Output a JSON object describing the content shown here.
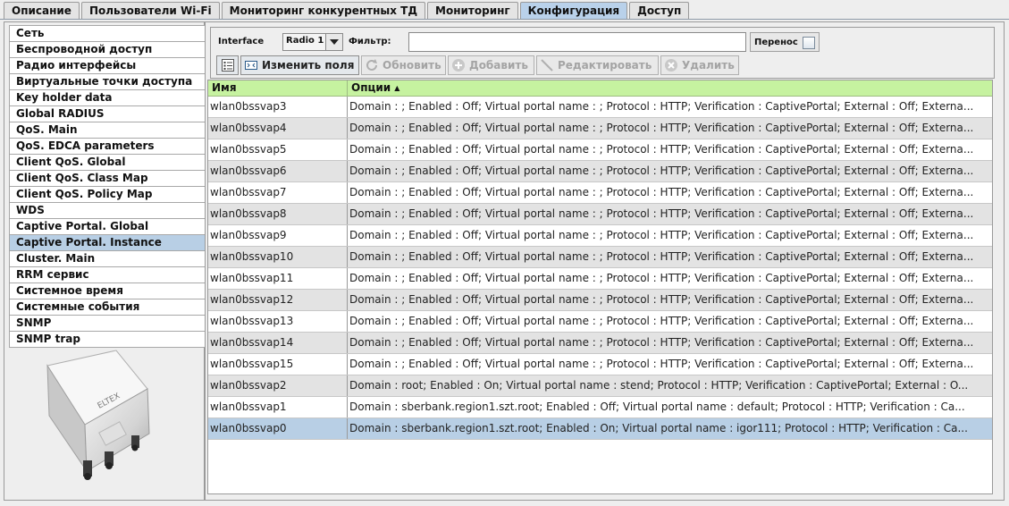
{
  "tabs": [
    {
      "label": "Описание",
      "active": false
    },
    {
      "label": "Пользователи Wi-Fi",
      "active": false
    },
    {
      "label": "Мониторинг конкурентных ТД",
      "active": false
    },
    {
      "label": "Мониторинг",
      "active": false
    },
    {
      "label": "Конфигурация",
      "active": true
    },
    {
      "label": "Доступ",
      "active": false
    }
  ],
  "menu": {
    "items": [
      "Сеть",
      "Беспроводной доступ",
      "Радио интерфейсы",
      "Виртуальные точки доступа",
      "Key holder data",
      "Global RADIUS",
      "QoS. Main",
      "QoS. EDCA parameters",
      "Client QoS. Global",
      "Client QoS. Class Map",
      "Client QoS. Policy Map",
      "WDS",
      "Captive Portal. Global",
      "Captive Portal. Instance",
      "Cluster. Main",
      "RRM сервис",
      "Системное время",
      "Системные события",
      "SNMP",
      "SNMP trap"
    ],
    "selected": "Captive Portal. Instance"
  },
  "device": {
    "brand_label": "ELTEX"
  },
  "filters": {
    "interface_label": "Interface",
    "interface_value": "Radio 1",
    "filter_label": "Фильтр:",
    "filter_value": "",
    "wrap_label": "Перенос",
    "wrap_checked": false
  },
  "toolbar": {
    "change_fields": "Изменить поля",
    "refresh": "Обновить",
    "add": "Добавить",
    "edit": "Редактировать",
    "delete": "Удалить"
  },
  "table": {
    "columns": [
      "Имя",
      "Опции"
    ],
    "sorted_column": "Опции",
    "sort_direction": "ascending",
    "header_color": "#c6f2a0",
    "selected_row": "wlan0bssvap0",
    "rows": [
      {
        "name": "wlan0bssvap3",
        "options": "Domain : ; Enabled : Off; Virtual portal name : ; Protocol : HTTP; Verification : CaptivePortal; External : Off; Externa..."
      },
      {
        "name": "wlan0bssvap4",
        "options": "Domain : ; Enabled : Off; Virtual portal name : ; Protocol : HTTP; Verification : CaptivePortal; External : Off; Externa..."
      },
      {
        "name": "wlan0bssvap5",
        "options": "Domain : ; Enabled : Off; Virtual portal name : ; Protocol : HTTP; Verification : CaptivePortal; External : Off; Externa..."
      },
      {
        "name": "wlan0bssvap6",
        "options": "Domain : ; Enabled : Off; Virtual portal name : ; Protocol : HTTP; Verification : CaptivePortal; External : Off; Externa..."
      },
      {
        "name": "wlan0bssvap7",
        "options": "Domain : ; Enabled : Off; Virtual portal name : ; Protocol : HTTP; Verification : CaptivePortal; External : Off; Externa..."
      },
      {
        "name": "wlan0bssvap8",
        "options": "Domain : ; Enabled : Off; Virtual portal name : ; Protocol : HTTP; Verification : CaptivePortal; External : Off; Externa..."
      },
      {
        "name": "wlan0bssvap9",
        "options": "Domain : ; Enabled : Off; Virtual portal name : ; Protocol : HTTP; Verification : CaptivePortal; External : Off; Externa..."
      },
      {
        "name": "wlan0bssvap10",
        "options": "Domain : ; Enabled : Off; Virtual portal name : ; Protocol : HTTP; Verification : CaptivePortal; External : Off; Externa..."
      },
      {
        "name": "wlan0bssvap11",
        "options": "Domain : ; Enabled : Off; Virtual portal name : ; Protocol : HTTP; Verification : CaptivePortal; External : Off; Externa..."
      },
      {
        "name": "wlan0bssvap12",
        "options": "Domain : ; Enabled : Off; Virtual portal name : ; Protocol : HTTP; Verification : CaptivePortal; External : Off; Externa..."
      },
      {
        "name": "wlan0bssvap13",
        "options": "Domain : ; Enabled : Off; Virtual portal name : ; Protocol : HTTP; Verification : CaptivePortal; External : Off; Externa..."
      },
      {
        "name": "wlan0bssvap14",
        "options": "Domain : ; Enabled : Off; Virtual portal name : ; Protocol : HTTP; Verification : CaptivePortal; External : Off; Externa..."
      },
      {
        "name": "wlan0bssvap15",
        "options": "Domain : ; Enabled : Off; Virtual portal name : ; Protocol : HTTP; Verification : CaptivePortal; External : Off; Externa..."
      },
      {
        "name": "wlan0bssvap2",
        "options": "Domain : root; Enabled : On; Virtual portal name : stend; Protocol : HTTP; Verification : CaptivePortal; External : O..."
      },
      {
        "name": "wlan0bssvap1",
        "options": "Domain : sberbank.region1.szt.root; Enabled : Off; Virtual portal name : default; Protocol : HTTP; Verification : Ca..."
      },
      {
        "name": "wlan0bssvap0",
        "options": "Domain : sberbank.region1.szt.root; Enabled : On; Virtual portal name : igor111; Protocol : HTTP; Verification : Ca..."
      }
    ]
  }
}
